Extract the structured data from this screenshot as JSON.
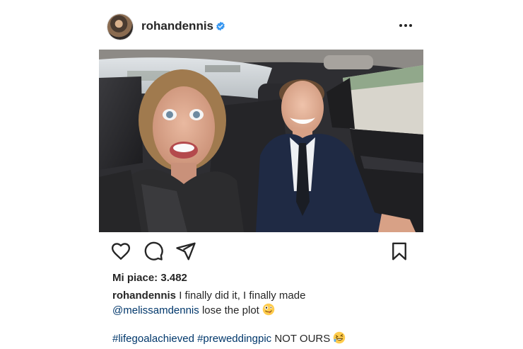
{
  "post": {
    "username": "rohandennis",
    "likes_label": "Mi piace: 3.482",
    "caption_text": "I finally did it, I finally made",
    "caption_mention": "@melissamdennis",
    "caption_rest": "lose the plot",
    "hashtag_1": "#lifegoalachieved",
    "hashtag_2": "#preweddingpic",
    "hashtag_tail": "NOT OURS"
  },
  "icons": {
    "verified": "verified-badge-icon",
    "more": "more-options-icon",
    "like": "heart-icon",
    "comment": "comment-icon",
    "share": "send-icon",
    "save": "bookmark-icon",
    "emoji_1": "zany-face-emoji",
    "emoji_2": "rofl-emoji"
  },
  "colors": {
    "verified": "#3897f0",
    "link": "#00376b",
    "text": "#262626"
  }
}
